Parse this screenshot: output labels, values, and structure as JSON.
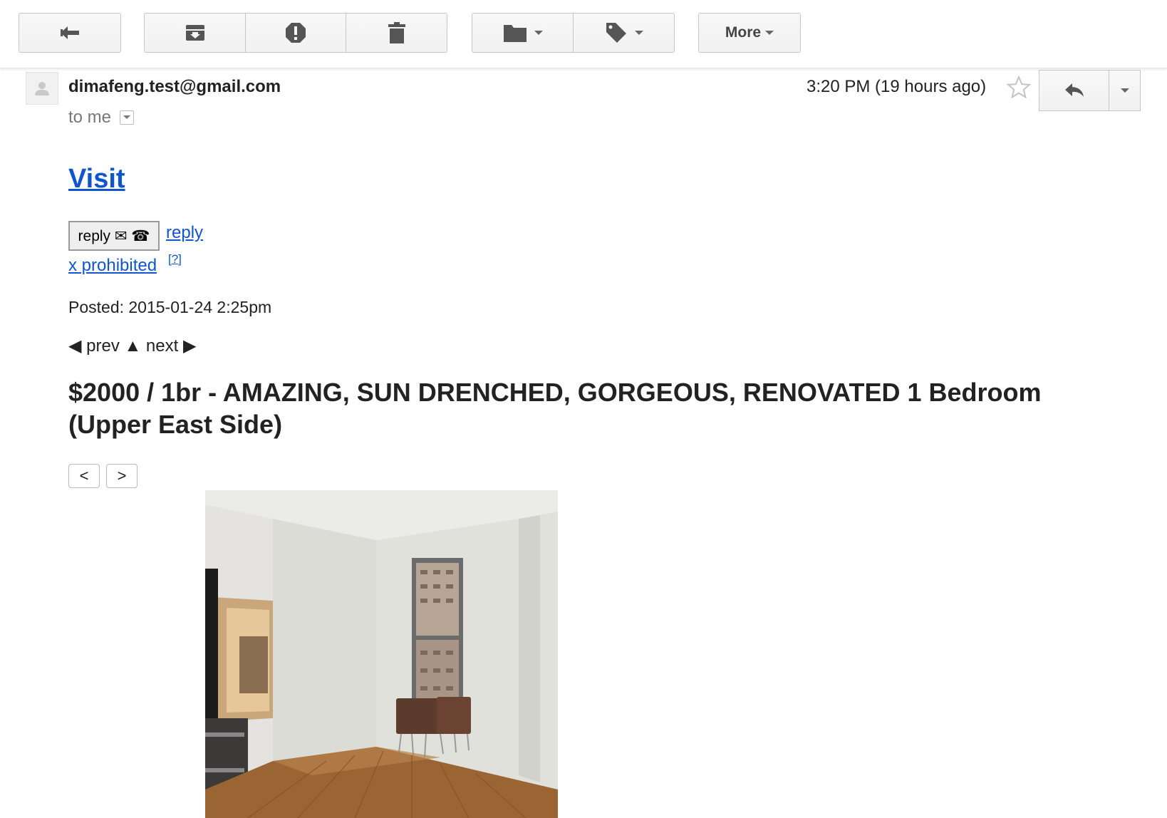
{
  "toolbar": {
    "more_label": "More"
  },
  "message": {
    "sender": "dimafeng.test@gmail.com",
    "recipient": "to me",
    "timestamp": "3:20 PM (19 hours ago)"
  },
  "listing": {
    "visit_link": "Visit",
    "reply_button": "reply ✉ ☎",
    "reply_link": "reply",
    "prohibited_link": "x prohibited",
    "help_link": "[?]",
    "posted": "Posted: 2015-01-24 2:25pm",
    "nav_prev": "◀ prev",
    "nav_up": "▲",
    "nav_next": "next ▶",
    "title_line1": "$2000 / 1br - AMAZING, SUN DRENCHED, GORGEOUS, RENOVATED 1 Bedroom",
    "title_line2": "(Upper East Side)",
    "image_prev": "<",
    "image_next": ">"
  },
  "colors": {
    "link": "#1155cc",
    "toolbar_button": "#f5f5f5",
    "border": "#c6c6c6"
  }
}
